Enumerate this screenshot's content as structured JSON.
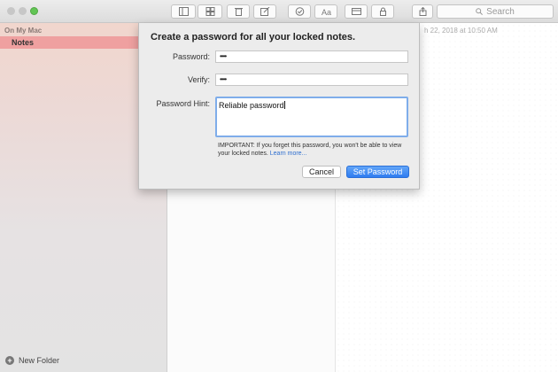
{
  "toolbar": {
    "buttons": [
      "sidebar-toggle-icon",
      "gallery-view-icon",
      "trash-icon",
      "compose-icon",
      "checklist-icon",
      "text-format-icon",
      "table-icon",
      "lock-icon",
      "share-icon"
    ],
    "search_placeholder": "Search"
  },
  "sidebar": {
    "section_label": "On My Mac",
    "folder": "Notes",
    "new_folder_label": "New Folder"
  },
  "editor": {
    "date_fragment": "h 22, 2018 at 10:50 AM"
  },
  "dialog": {
    "title": "Create a password for all your locked notes.",
    "password_label": "Password:",
    "password_value": "••••",
    "verify_label": "Verify:",
    "verify_value": "••••",
    "hint_label": "Password Hint:",
    "hint_value": "Reliable password",
    "important_text": "IMPORTANT: If you forget this password, you won't be able to view your locked notes.",
    "learn_more": "Learn more...",
    "cancel_label": "Cancel",
    "set_label": "Set Password"
  },
  "colors": {
    "selected_folder": "#efa0a0",
    "primary_button": "#2f7cf0",
    "focus_ring": "#7fadea"
  }
}
